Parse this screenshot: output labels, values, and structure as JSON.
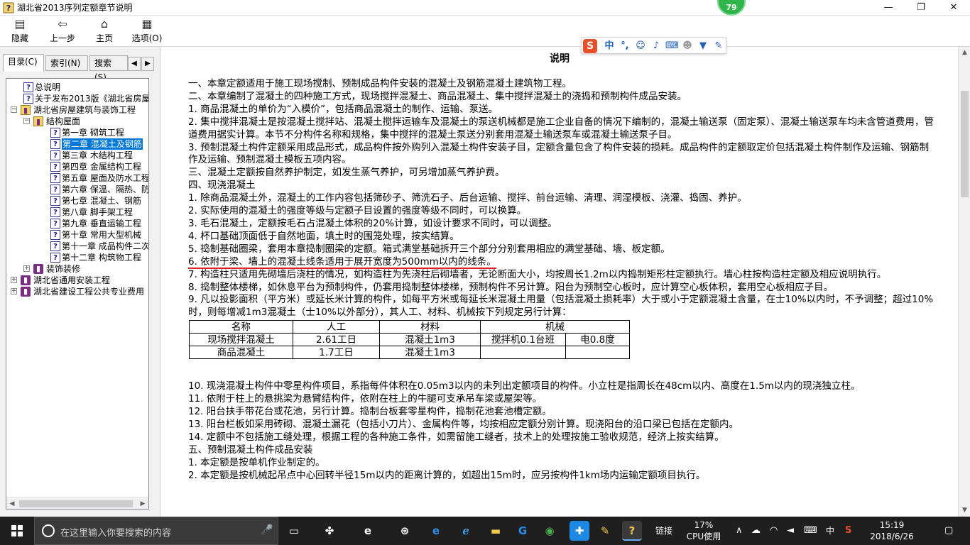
{
  "window": {
    "title": "湖北省2013序列定额章节说明",
    "badge": "79",
    "minimize": "—",
    "maximize": "❐",
    "close": "✕"
  },
  "toolbar": {
    "hide": "隐藏",
    "back": "上一步",
    "home": "主页",
    "options": "选项(O)"
  },
  "tabs": {
    "contents": "目录(C)",
    "index": "索引(N)",
    "search": "搜索(S)"
  },
  "tree": [
    {
      "label": "总说明"
    },
    {
      "label": "关于发布2013版《湖北省房屋"
    },
    {
      "label": "湖北省房屋建筑与装饰工程"
    },
    {
      "label": "结构屋面"
    },
    {
      "label": "第一章  砌筑工程"
    },
    {
      "label": "第二章  混凝土及钢筋"
    },
    {
      "label": "第三章  木结构工程"
    },
    {
      "label": "第四章  金属结构工程"
    },
    {
      "label": "第五章  屋面及防水工程"
    },
    {
      "label": "第六章  保温、隔热、防"
    },
    {
      "label": "第七章  混凝土、钢筋"
    },
    {
      "label": "第八章  脚手架工程"
    },
    {
      "label": "第九章  垂直运输工程"
    },
    {
      "label": "第十章  常用大型机械"
    },
    {
      "label": "第十一章  成品构件二次"
    },
    {
      "label": "第十二章  构筑物工程"
    },
    {
      "label": "装饰装修"
    },
    {
      "label": "湖北省通用安装工程"
    },
    {
      "label": "湖北省建设工程公共专业费用"
    }
  ],
  "doc": {
    "title": "说明",
    "lines": [
      "一、本章定额适用于施工现场搅制、预制成品构件安装的混凝土及钢筋混凝土建筑物工程。",
      "二、本章编制了混凝土的四种施工方式，现场搅拌混凝土、商品混凝土、集中搅拌混凝土的浇捣和预制构件成品安装。",
      "1. 商品混凝土的单价为“入模价”，包括商品混凝土的制作、运输、泵送。",
      "2. 集中搅拌混凝土是按混凝土搅拌站、混凝土搅拌运输车及混凝土的泵送机械都是施工企业自备的情况下编制的，混凝土输送泵（固定泵）、混凝土输送泵车均未含管道费用，管道费用据实计算。本节不分构件名称和规格，集中搅拌的混凝土泵送分别套用混凝土输送泵车或混凝土输送泵子目。",
      "3. 预制混凝土构件定额采用成品形式，成品构件按外购列入混凝土构件安装子目，定额含量包含了构件安装的损耗。成品构件的定额取定价包括混凝土构件制作及运输、钢筋制作及运输、预制混凝土模板五项内容。",
      "三、混凝土定额按自然养护制定，如发生蒸气养护，可另增加蒸气养护费。",
      "四、现浇混凝土",
      "1. 除商品混凝土外，混凝土的工作内容包括筛砂子、筛洗石子、后台运输、搅拌、前台运输、清理、润湿模板、浇灌、捣固、养护。",
      "2. 实际使用的混凝土的强度等级与定额子目设置的强度等级不同时，可以换算。",
      "3. 毛石混凝土，定额按毛石占混凝土体积的20%计算，如设计要求不同时，可以调整。",
      "4. 杯口基础顶面低于自然地面，填土时的围笼处理，按实结算。",
      "5. 捣制基础圈梁，套用本章捣制圈梁的定额。箱式满堂基础拆开三个部分分别套用相应的满堂基础、墙、板定额。",
      "6. 依附于梁、墙上的混凝土线条适用于展开宽度为500mm以内的线条。",
      "7. 构造柱只适用先砌墙后浇柱的情况，如构造柱为先浇柱后砌墙者，无论断面大小，均按周长1.2m以内捣制矩形柱定额执行。墙心柱按构造柱定额及相应说明执行。",
      "8. 捣制整体楼梯，如休息平台为预制构件，仍套用捣制整体楼梯，预制构件不另计算。阳台为预制空心板时，应计算空心板体积，套用空心板相应子目。",
      "9. 凡以投影面积（平方米）或延长米计算的构件，如每平方米或每延长米混凝土用量（包括混凝土损耗率）大于或小于定额混凝土含量，在士10%以内时，不予调整；超过10%时，则每增减1m3混凝土（士10%以外部分），其人工、材料、机械按下列规定另行计算："
    ],
    "table": {
      "headers": [
        "名称",
        "人工",
        "材料",
        "机械"
      ],
      "rows": [
        [
          "现场搅拌混凝土",
          "2.61工日",
          "混凝土1m3",
          "搅拌机0.1台班",
          "电0.8度"
        ],
        [
          "商品混凝土",
          "1.7工日",
          "混凝土1m3",
          "",
          ""
        ]
      ]
    },
    "lines2": [
      "10. 现浇混凝土构件中零星构件项目，系指每件体积在0.05m3以内的未列出定额项目的构件。小立柱是指周长在48cm以内、高度在1.5m以内的现浇独立柱。",
      "11. 依附于柱上的悬挑梁为悬臂结构件，依附在柱上的牛腿可支承吊车梁或屋架等。",
      "12. 阳台扶手带花台或花池，另行计算。捣制台板套零星构件，捣制花池套池槽定额。",
      "13. 阳台栏板如采用砖砌、混凝土漏花（包括小刀片）、金属构件等，均按相应定额分别计算。现浇阳台的沿口梁已包括在定额内。",
      "14. 定额中不包括施工缝处理，根据工程的各种施工条件，如需留施工缝者，技术上的处理按施工验收规范，经济上按实结算。",
      "五、预制混凝土构件成品安装",
      "1. 本定额是按单机作业制定的。",
      "2. 本定额是按机械起吊点中心回转半径15m以内的距离计算的，如超出15m时，应另按构件1km场内运输定额项目执行。"
    ]
  },
  "ime": {
    "logo": "S",
    "lang": "中"
  },
  "taskbar": {
    "search_placeholder": "在这里输入你要搜索的内容",
    "link": "链接",
    "cpu_percent": "17%",
    "cpu_label": "CPU使用",
    "input_lang": "中",
    "time": "15:19",
    "date": "2018/6/26"
  }
}
